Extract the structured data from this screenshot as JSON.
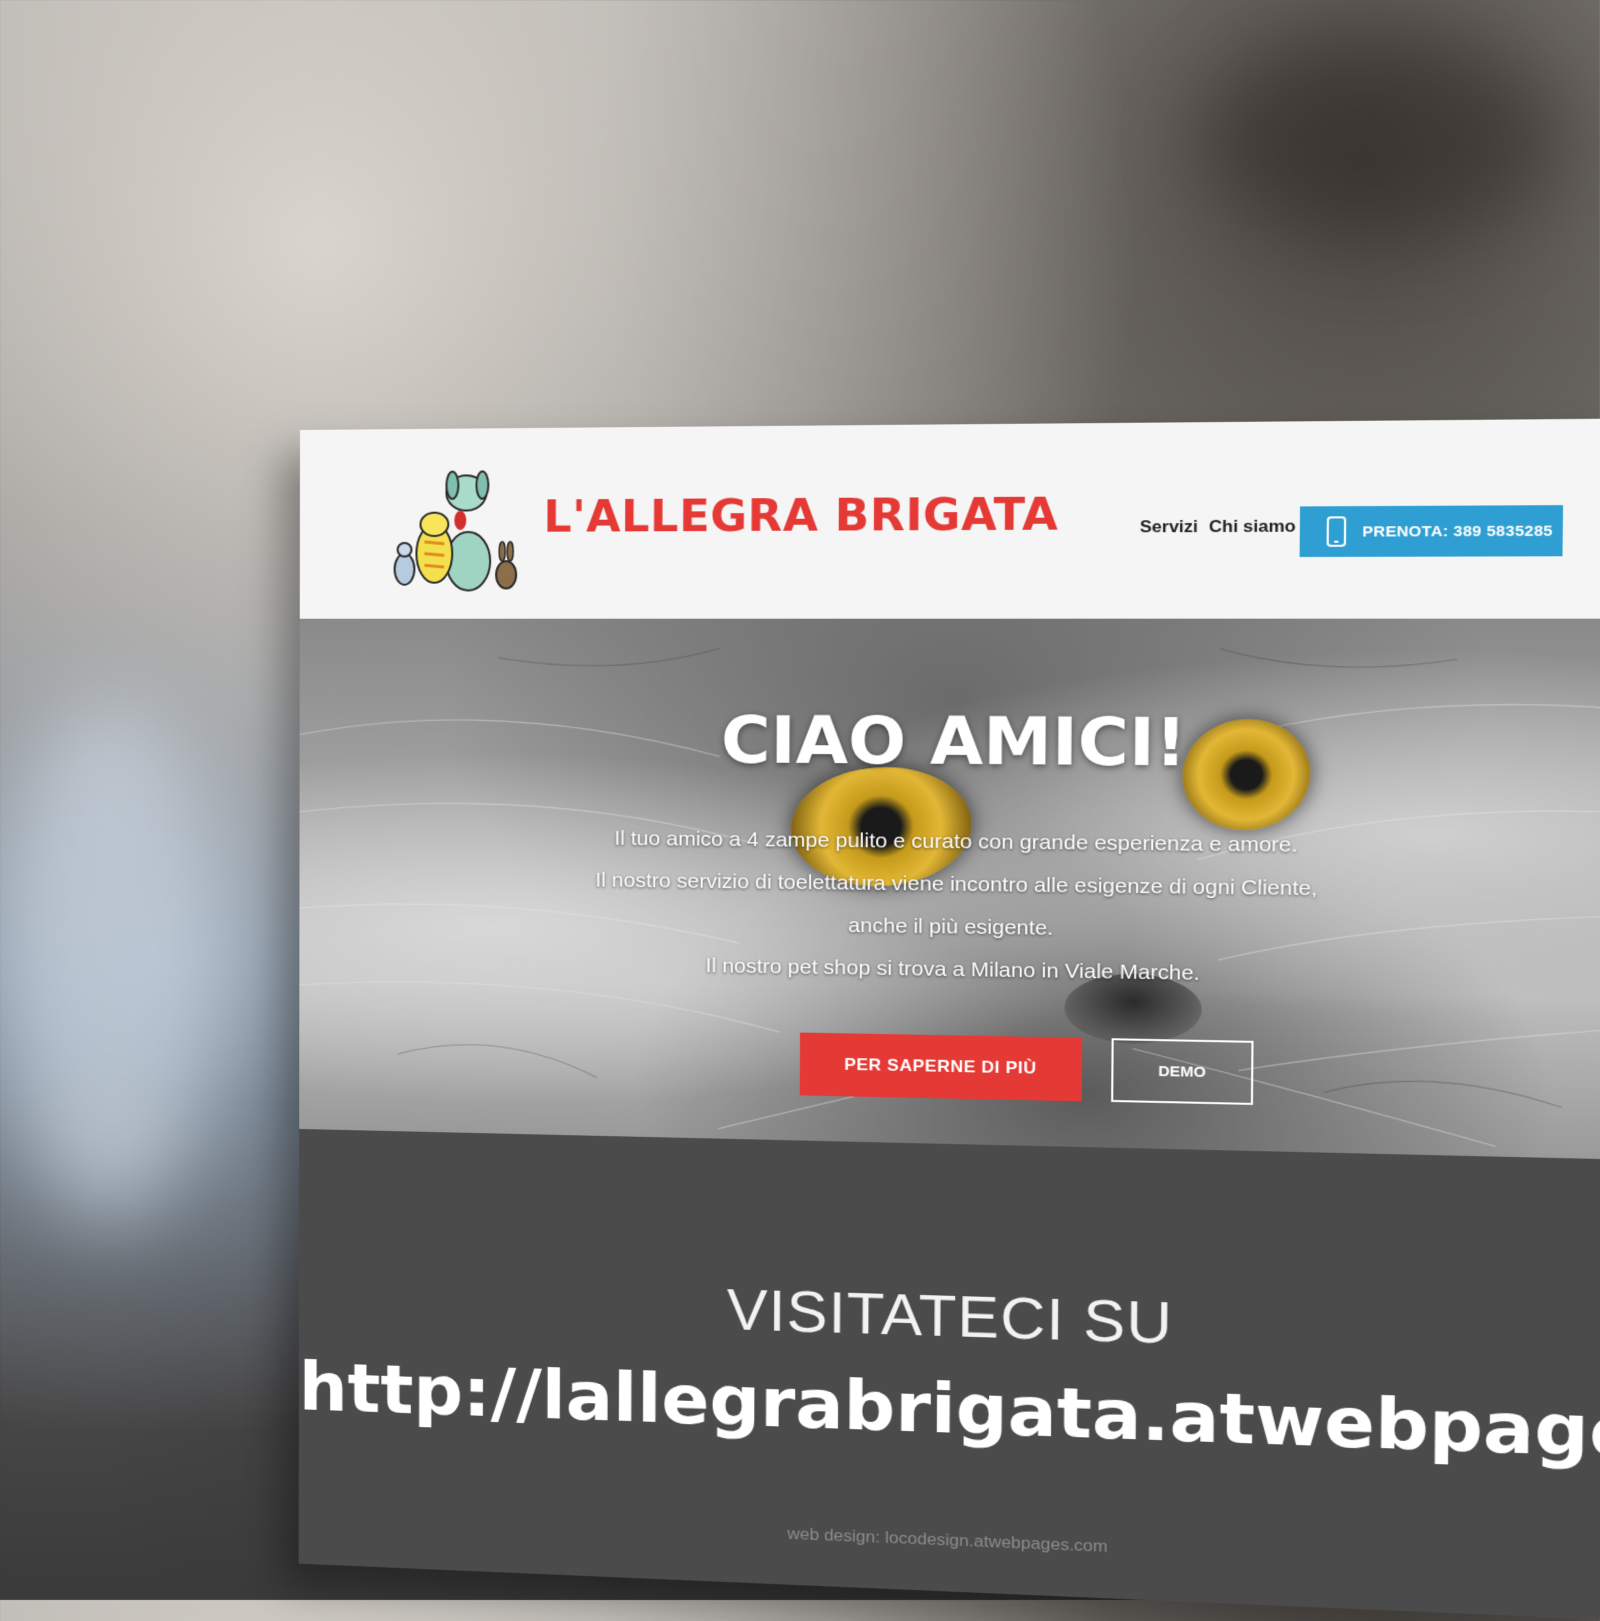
{
  "header": {
    "brand": "L'ALLEGRA BRIGATA",
    "nav": {
      "servizi": "Servizi",
      "chi_siamo": "Chi siamo"
    },
    "book_button": "PRENOTA: 389 5835285"
  },
  "hero": {
    "title": "CIAO AMICI!",
    "lines": [
      "Il tuo amico a 4 zampe pulito e curato con grande esperienza e amore.",
      "Il nostro servizio di toelettatura viene incontro alle esigenze di ogni Cliente,",
      "anche il più esigente.",
      "Il nostro pet shop si trova a Milano in Viale Marche."
    ],
    "primary_button": "PER SAPERNE DI PIÙ",
    "secondary_button": "DEMO"
  },
  "promo": {
    "heading": "VISITATECI SU",
    "url": "http://lallegrabrigata.atwebpages.com",
    "credit": "web design: locodesign.atwebpages.com"
  },
  "colors": {
    "brand_red": "#e53935",
    "book_blue": "#2f9fd3",
    "band_gray": "#4b4b4b"
  },
  "icons": {
    "phone": "phone-icon",
    "logo": "cartoon-animals-logo"
  }
}
